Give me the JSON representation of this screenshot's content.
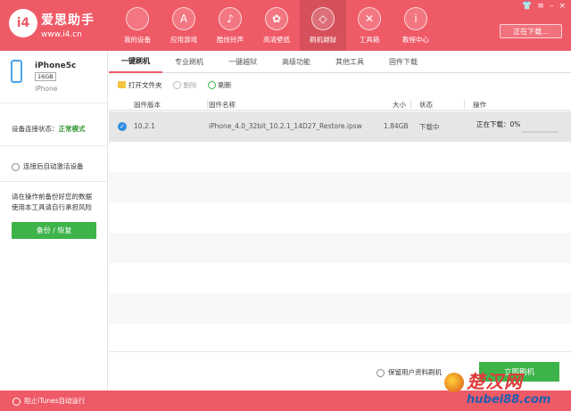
{
  "app": {
    "logo_text": "i4",
    "name": "爱思助手",
    "url": "www.i4.cn"
  },
  "nav": [
    {
      "label": "我的设备",
      "icon": "apple-icon",
      "glyph": ""
    },
    {
      "label": "应用游戏",
      "icon": "app-store-icon",
      "glyph": "A"
    },
    {
      "label": "酷炫铃声",
      "icon": "bell-icon",
      "glyph": "♪"
    },
    {
      "label": "高清壁纸",
      "icon": "flower-icon",
      "glyph": "✿"
    },
    {
      "label": "刷机越狱",
      "icon": "dropbox-icon",
      "glyph": "◇"
    },
    {
      "label": "工具箱",
      "icon": "tools-icon",
      "glyph": "✕"
    },
    {
      "label": "教程中心",
      "icon": "info-icon",
      "glyph": "i"
    }
  ],
  "window": {
    "ctrl_skin": "👕",
    "ctrl_menu": "≡",
    "ctrl_min": "–",
    "ctrl_close": "×",
    "download_btn": "正在下载..."
  },
  "device": {
    "name": "iPhone5c",
    "capacity": "16GB",
    "type": "iPhone",
    "status_label": "设备连接状态：",
    "status_value": "正常模式",
    "auto_activate": "连接后自动激活设备",
    "warning_line1": "请在操作前备份好您的数据",
    "warning_line2": "使用本工具请自行承担风险",
    "backup_button": "备份 / 恢复"
  },
  "bottom": {
    "itunes_label": "阻止iTunes自动运行"
  },
  "tabs": [
    "一键刷机",
    "专业刷机",
    "一键越狱",
    "高级功能",
    "其他工具",
    "固件下载"
  ],
  "toolbar": {
    "open_folder": "打开文件夹",
    "delete": "删除",
    "refresh": "刷新"
  },
  "table": {
    "headers": {
      "version": "固件版本",
      "name": "固件名称",
      "size": "大小",
      "state": "状态",
      "action": "操作"
    },
    "rows": [
      {
        "version": "10.2.1",
        "name": "iPhone_4.0_32bit_10.2.1_14D27_Restore.ipsw",
        "size": "1.84GB",
        "state": "下载中",
        "action": "正在下载：0%",
        "progress": 0
      }
    ]
  },
  "footer": {
    "keep_data": "保留用户资料刷机",
    "flash_button": "立即刷机"
  },
  "watermark": {
    "big": "楚汉网",
    "url": "hubei88.com"
  },
  "colors": {
    "brand": "#ef5a67",
    "ok_green": "#3a9a3a",
    "button_green": "#3eb34a",
    "check_blue": "#2f8fe0"
  }
}
